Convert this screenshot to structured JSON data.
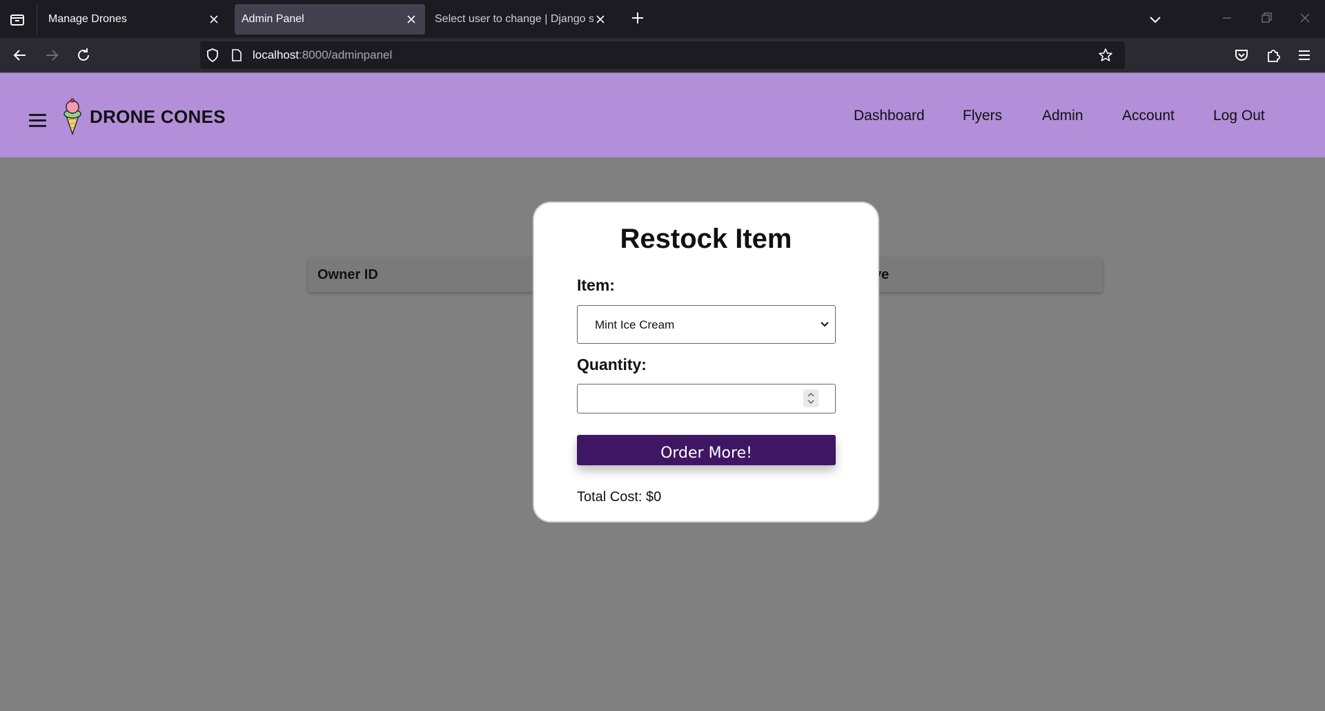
{
  "browser": {
    "tabs": [
      {
        "title": "Manage Drones",
        "active": false
      },
      {
        "title": "Admin Panel",
        "active": true
      },
      {
        "title": "Select user to change | Django site a",
        "active": false
      }
    ],
    "url": {
      "host": "localhost",
      "path": ":8000/adminpanel"
    }
  },
  "header": {
    "brand": "DRONE CONES",
    "nav": [
      "Dashboard",
      "Flyers",
      "Admin",
      "Account",
      "Log Out"
    ]
  },
  "table": {
    "columns": [
      "Owner ID",
      "ve"
    ]
  },
  "modal": {
    "title": "Restock Item",
    "item_label": "Item:",
    "item_value": "Mint Ice Cream",
    "quantity_label": "Quantity:",
    "quantity_value": "",
    "order_button": "Order More!",
    "total_cost": "Total Cost: $0"
  },
  "colors": {
    "header_bg": "#b38ed9",
    "overlay_bg": "#808080",
    "button_bg": "#3f1664"
  }
}
